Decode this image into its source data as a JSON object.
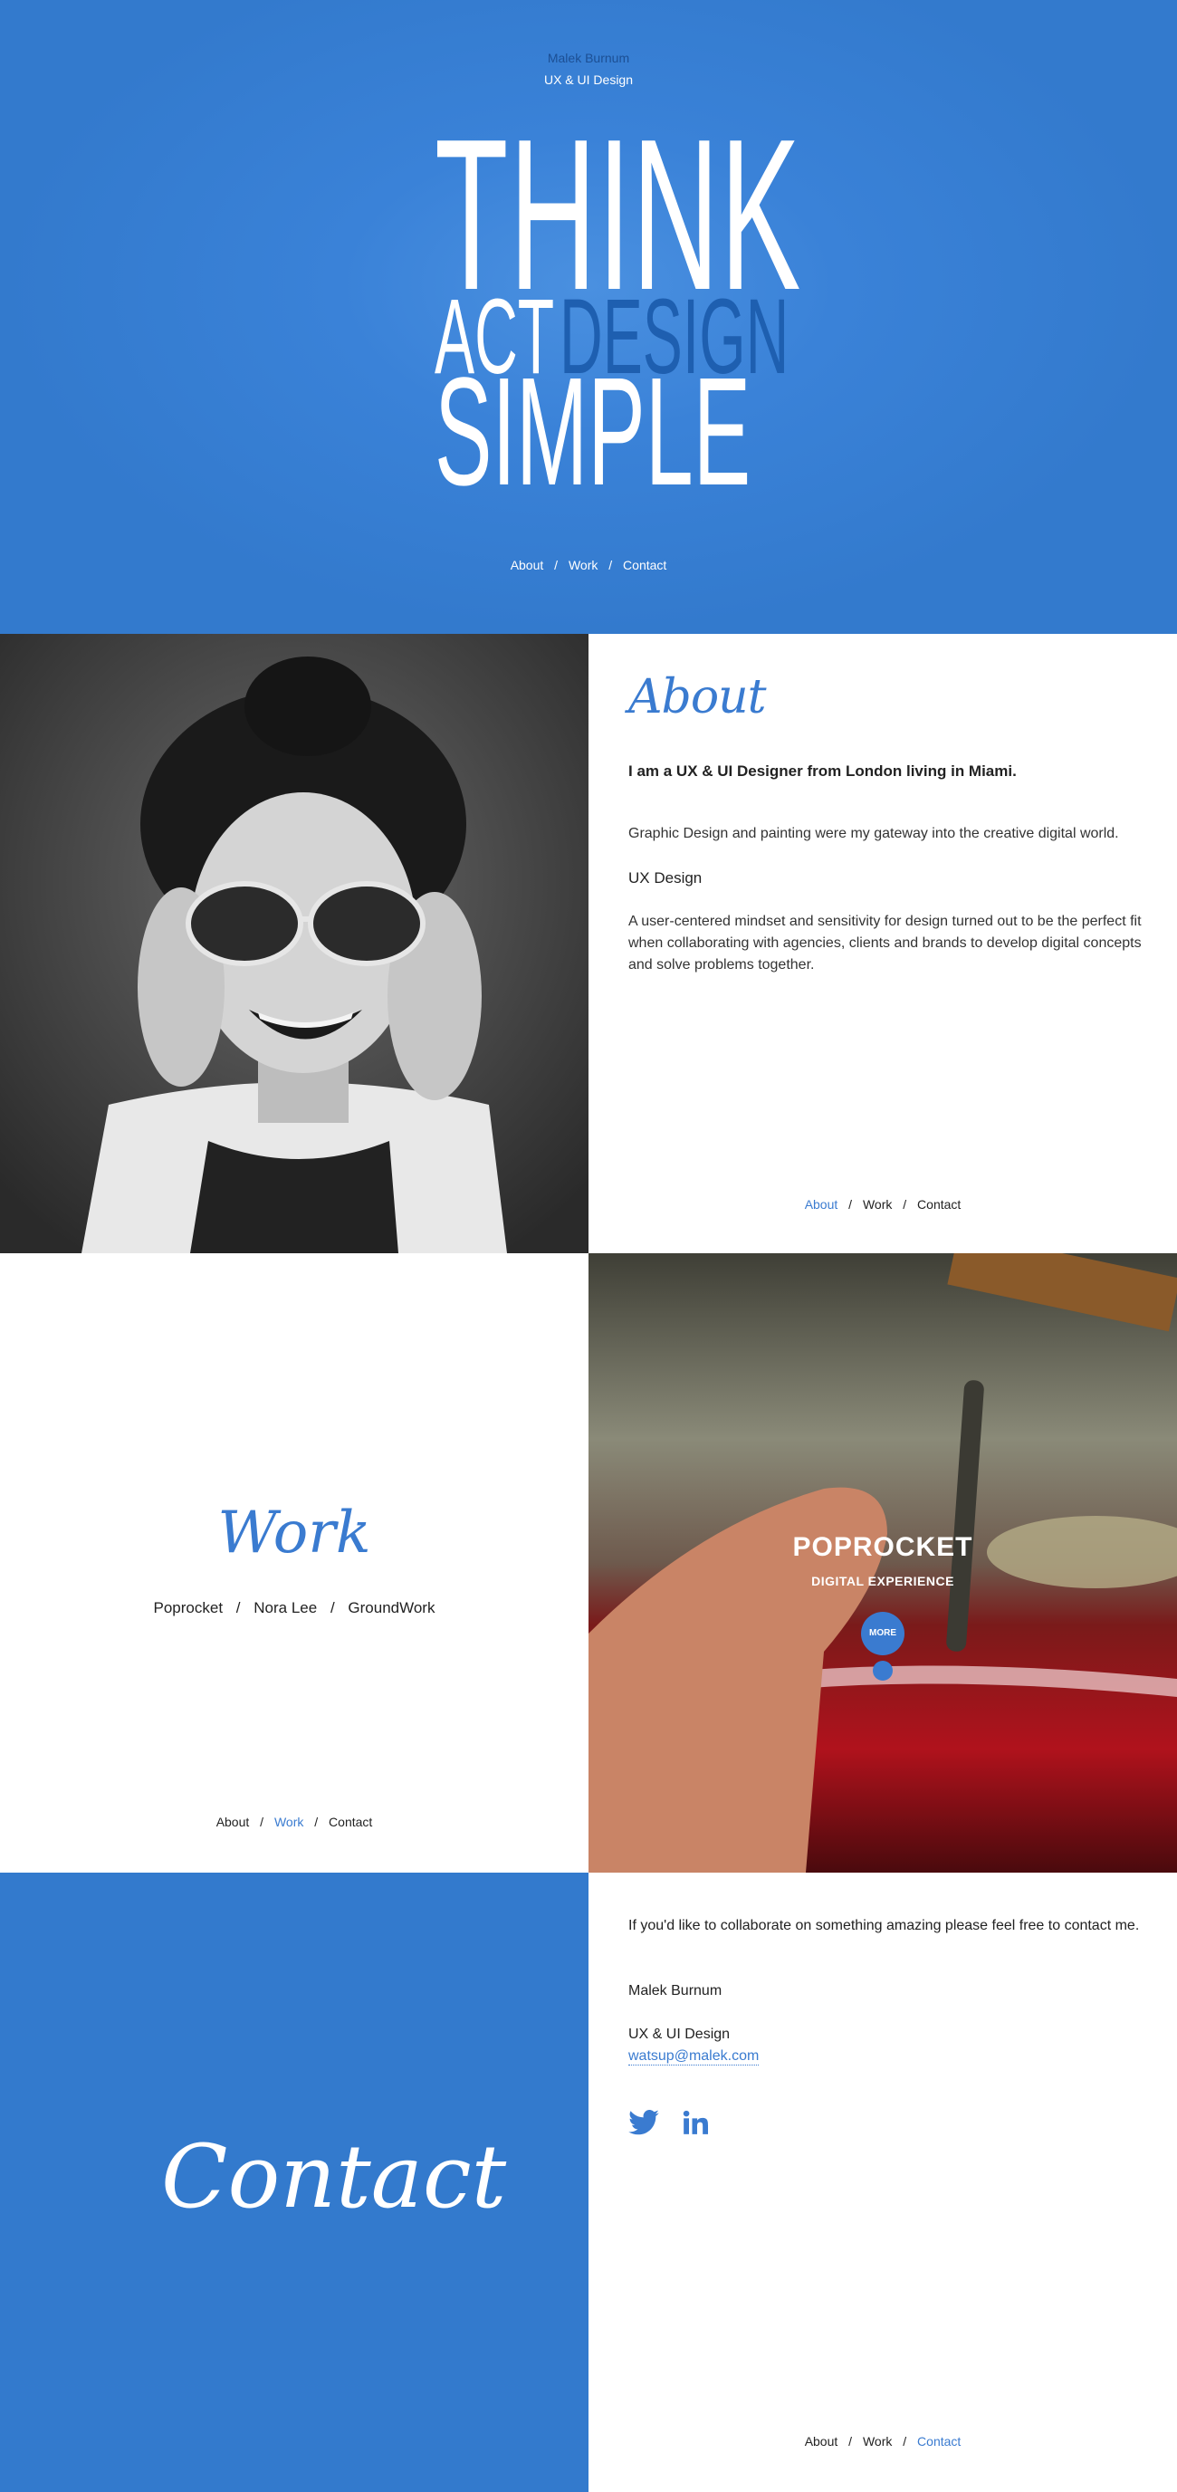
{
  "hero": {
    "owner": "Malek Burnum",
    "role": "UX & UI Design",
    "headline": {
      "think": "THINK",
      "act": "ACT",
      "design": "DESIGN",
      "simple": "SIMPLE"
    },
    "nav": {
      "about": "About",
      "work": "Work",
      "contact": "Contact",
      "sep": "/"
    }
  },
  "about": {
    "title": "About",
    "lead": "I am a UX & UI Designer from London living in Miami.",
    "paragraph1": "Graphic Design and painting were my gateway into the creative digital world.",
    "subheading": "UX Design",
    "paragraph2": "A user-centered mindset and sensitivity for design turned out to be the perfect fit when collaborating with agencies, clients and brands to develop digital concepts and solve problems together.",
    "nav": {
      "about": "About",
      "work": "Work",
      "contact": "Contact",
      "sep": "/"
    }
  },
  "work": {
    "title": "Work",
    "projects": [
      "Poprocket",
      "Nora Lee",
      "GroundWork"
    ],
    "projects_sep": "/",
    "nav": {
      "about": "About",
      "work": "Work",
      "contact": "Contact",
      "sep": "/"
    },
    "feature": {
      "title": "POPROCKET",
      "subtitle": "DIGITAL EXPERIENCE",
      "button": "MORE"
    }
  },
  "contact": {
    "title": "Contact",
    "intro": "If you'd like  to collaborate on something amazing please feel free to contact me.",
    "name": "Malek Burnum",
    "role": "UX & UI Design",
    "email": "watsup@malek.com",
    "social": [
      "twitter-icon",
      "linkedin-icon"
    ],
    "nav": {
      "about": "About",
      "work": "Work",
      "contact": "Contact",
      "sep": "/"
    }
  },
  "colors": {
    "brand_blue": "#337acd",
    "accent_blue": "#3a7bd0",
    "design_word": "#1e5fb0"
  }
}
